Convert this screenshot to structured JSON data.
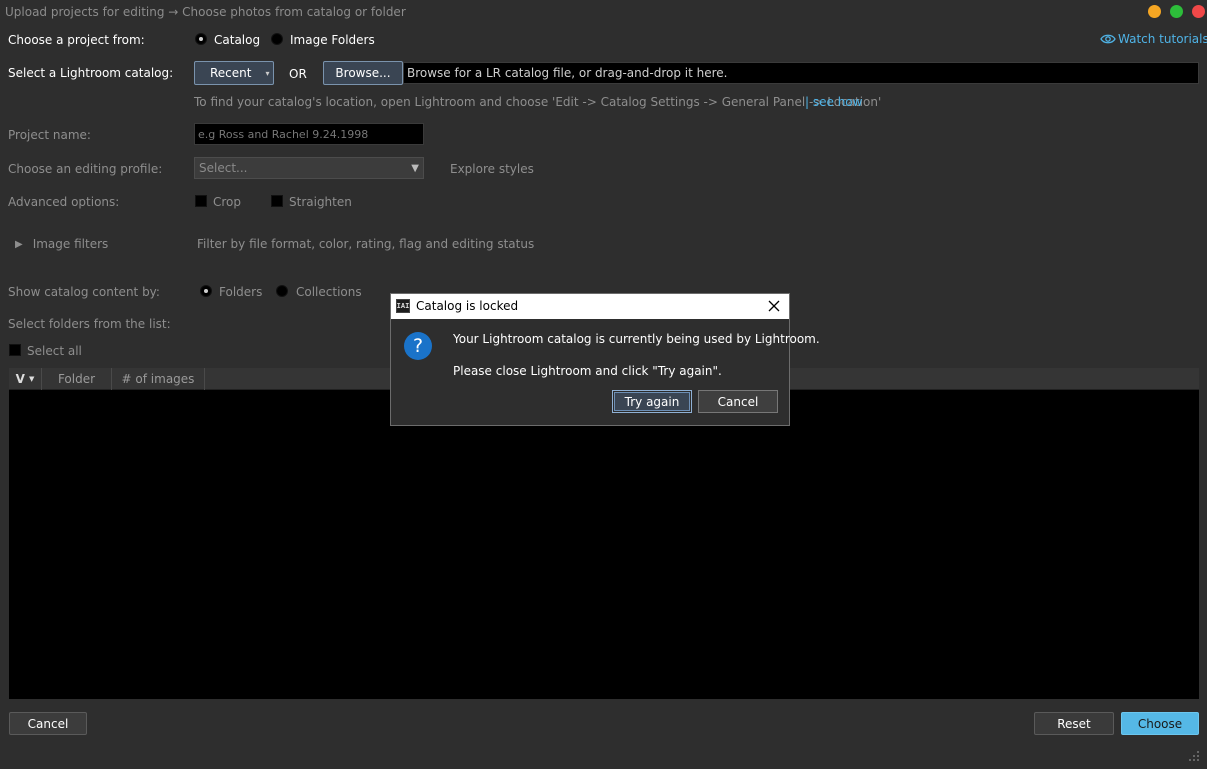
{
  "window": {
    "title": "Upload projects for editing → Choose photos from catalog or folder",
    "controls": {
      "minimize_color": "#f5a623",
      "maximize_color": "#2dbd3a",
      "close_color": "#f04848"
    }
  },
  "header": {
    "project_from_label": "Choose a project from:",
    "options": [
      "Catalog",
      "Image Folders"
    ],
    "selected": "Catalog",
    "watch_tutorials": "Watch tutorials"
  },
  "catalog": {
    "label": "Select a Lightroom catalog:",
    "recent_label": "Recent",
    "or_label": "OR",
    "browse_label": "Browse...",
    "browse_placeholder": "Browse for a LR catalog file, or drag-and-drop it here.",
    "hint": "To find your catalog's location, open Lightroom and choose 'Edit -> Catalog Settings -> General Panel -> Location'",
    "see_how": "| see how"
  },
  "project": {
    "name_label": "Project name:",
    "name_placeholder": "e.g Ross and Rachel 9.24.1998"
  },
  "profile": {
    "label": "Choose an editing profile:",
    "selected": "Select...",
    "explore": "Explore styles"
  },
  "advanced": {
    "label": "Advanced options:",
    "crop": "Crop",
    "straighten": "Straighten"
  },
  "filters": {
    "label": "Image filters",
    "description": "Filter by file format, color, rating, flag and editing status"
  },
  "content": {
    "label": "Show catalog content by:",
    "options": [
      "Folders",
      "Collections"
    ],
    "selected": "Folders",
    "folders_label": "Select folders from the list:",
    "select_all": "Select all"
  },
  "table": {
    "columns": [
      "V",
      "Folder",
      "# of images"
    ]
  },
  "footer": {
    "cancel": "Cancel",
    "reset": "Reset",
    "choose": "Choose",
    "accent": "#55b8e6"
  },
  "dialog": {
    "title": "Catalog is locked",
    "message_line1": "Your Lightroom catalog is currently being used by Lightroom.",
    "message_line2": "Please close Lightroom and click \"Try again\".",
    "try_again": "Try again",
    "cancel": "Cancel",
    "question_color": "#1a73c9"
  }
}
